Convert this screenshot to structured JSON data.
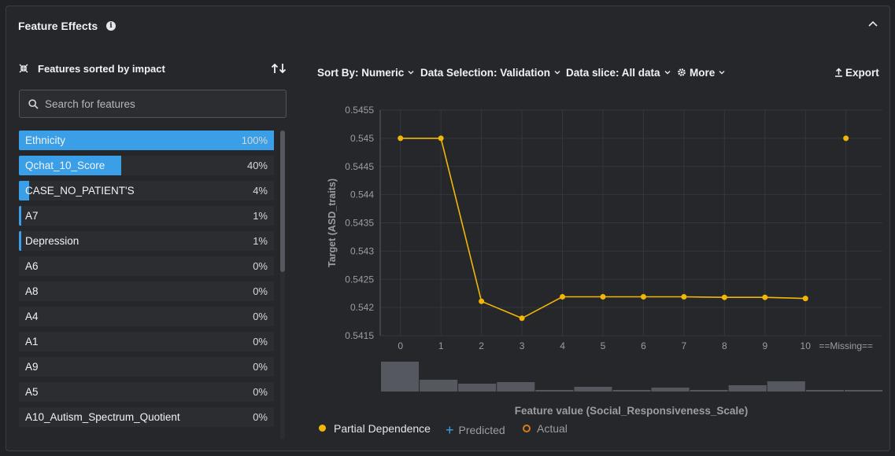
{
  "panel": {
    "title": "Feature Effects"
  },
  "features": {
    "header_label": "Features sorted by impact",
    "search_placeholder": "Search for features",
    "items": [
      {
        "name": "Ethnicity",
        "pct_label": "100%",
        "impact": 100
      },
      {
        "name": "Qchat_10_Score",
        "pct_label": "40%",
        "impact": 40
      },
      {
        "name": "CASE_NO_PATIENT'S",
        "pct_label": "4%",
        "impact": 4
      },
      {
        "name": "A7",
        "pct_label": "1%",
        "impact": 1
      },
      {
        "name": "Depression",
        "pct_label": "1%",
        "impact": 1
      },
      {
        "name": "A6",
        "pct_label": "0%",
        "impact": 0
      },
      {
        "name": "A8",
        "pct_label": "0%",
        "impact": 0
      },
      {
        "name": "A4",
        "pct_label": "0%",
        "impact": 0
      },
      {
        "name": "A1",
        "pct_label": "0%",
        "impact": 0
      },
      {
        "name": "A9",
        "pct_label": "0%",
        "impact": 0
      },
      {
        "name": "A5",
        "pct_label": "0%",
        "impact": 0
      },
      {
        "name": "A10_Autism_Spectrum_Quotient",
        "pct_label": "0%",
        "impact": 0
      }
    ]
  },
  "toolbar": {
    "sort_by": "Sort By: Numeric",
    "data_selection": "Data Selection: Validation",
    "data_slice": "Data slice: All data",
    "more": "More",
    "export": "Export"
  },
  "legend": {
    "partial_dependence": "Partial Dependence",
    "predicted": "Predicted",
    "actual": "Actual"
  },
  "colors": {
    "accent": "#3a9fe6",
    "partial_dependence": "#f2b705",
    "actual": "#d97a1a",
    "histogram": "#55585f"
  },
  "chart_data": {
    "type": "line",
    "xlabel": "Feature value (Social_Responsiveness_Scale)",
    "ylabel": "Target (ASD_traits)",
    "x_ticks": [
      "0",
      "1",
      "2",
      "3",
      "4",
      "5",
      "6",
      "7",
      "8",
      "9",
      "10",
      "==Missing=="
    ],
    "y_ticks": [
      "0.5455",
      "0.545",
      "0.5445",
      "0.544",
      "0.5435",
      "0.543",
      "0.5425",
      "0.542",
      "0.5415"
    ],
    "ylim": [
      0.5415,
      0.5455
    ],
    "grid": true,
    "series": [
      {
        "name": "Partial Dependence",
        "x": [
          0,
          1,
          2,
          3,
          4,
          5,
          6,
          7,
          8,
          9,
          10
        ],
        "y": [
          0.545,
          0.545,
          0.54211,
          0.54181,
          0.54219,
          0.54219,
          0.54219,
          0.54219,
          0.54218,
          0.54218,
          0.54216
        ]
      }
    ],
    "missing_value": 0.545,
    "histogram_counts": [
      38,
      15,
      10,
      12,
      2,
      6,
      2,
      5,
      2,
      8,
      13,
      2,
      2
    ]
  }
}
